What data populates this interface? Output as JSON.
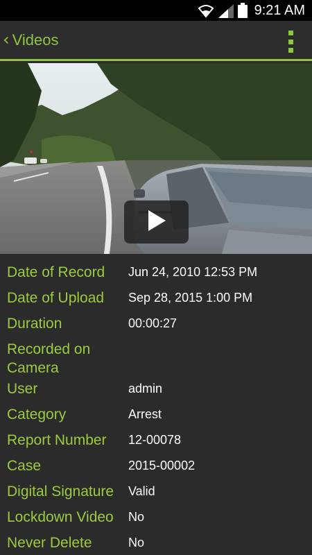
{
  "status_bar": {
    "time": "9:21 AM",
    "icons": [
      "wifi-icon",
      "signal-icon",
      "battery-icon"
    ]
  },
  "action_bar": {
    "back_icon": "‹",
    "back_label": "Videos",
    "menu_icon": "overflow-menu-icon"
  },
  "colors": {
    "accent": "#8dc63f",
    "label": "#9ccc3d",
    "background": "#2b2b2b"
  },
  "video": {
    "play_icon": "play-icon"
  },
  "details": [
    {
      "label": "Date of Record",
      "value": "Jun 24, 2010 12:53 PM"
    },
    {
      "label": "Date of Upload",
      "value": "Sep 28, 2015 1:00 PM"
    },
    {
      "label": "Duration",
      "value": "00:00:27"
    },
    {
      "label": "Recorded on Camera",
      "value": ""
    },
    {
      "label": "User",
      "value": "admin"
    },
    {
      "label": "Category",
      "value": "Arrest"
    },
    {
      "label": "Report Number",
      "value": "12-00078"
    },
    {
      "label": "Case",
      "value": "2015-00002"
    },
    {
      "label": "Digital Signature",
      "value": "Valid"
    },
    {
      "label": "Lockdown Video",
      "value": "No"
    },
    {
      "label": "Never Delete",
      "value": "No"
    }
  ]
}
